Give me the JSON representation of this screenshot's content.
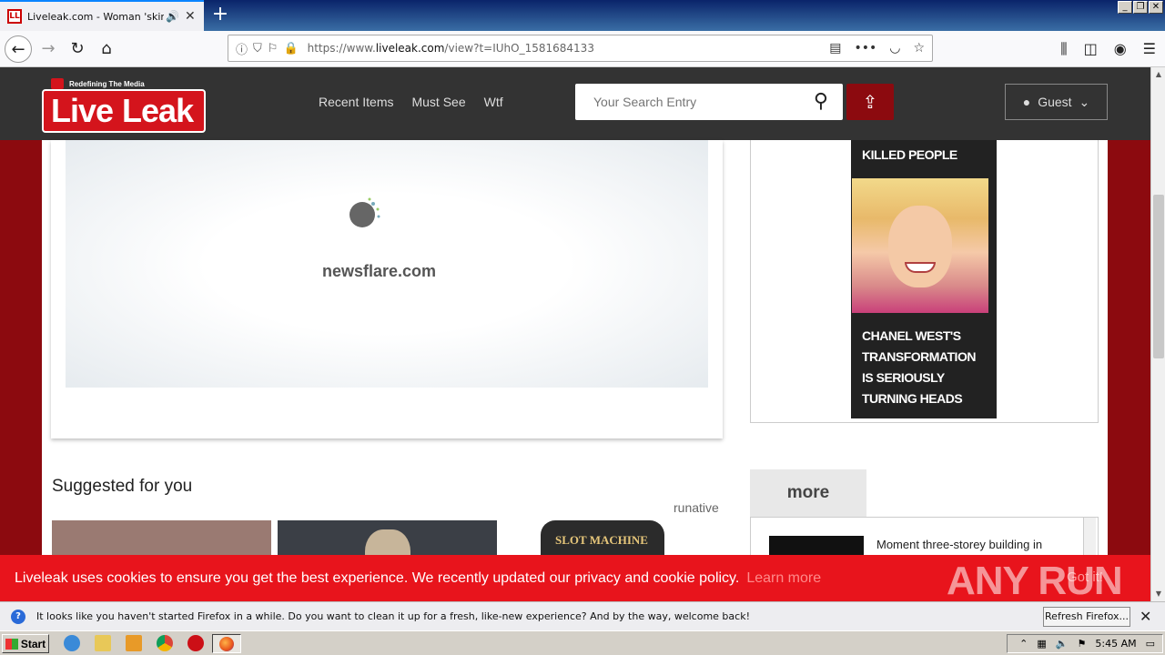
{
  "browser": {
    "tab_title": "Liveleak.com - Woman 'skinned",
    "favicon_text": "LL",
    "url_host": "https://www.",
    "url_domain": "liveleak.com",
    "url_path": "/view?t=IUhO_1581684133"
  },
  "site": {
    "logo_tagline": "Redefining The Media",
    "logo_live": "Live",
    "logo_leak": "Leak",
    "nav": [
      "Recent Items",
      "Must See",
      "Wtf"
    ],
    "search_placeholder": "Your Search Entry",
    "guest_label": "Guest"
  },
  "video": {
    "watermark": "newsflare.com"
  },
  "ad": {
    "headline": "KILLED PEOPLE",
    "caption": "CHANEL WEST'S TRANSFORMATION IS SERIOUSLY TURNING HEADS"
  },
  "suggested": {
    "title": "Suggested for you",
    "provider": "runative",
    "thumb3_text": "SLOT MACHINE"
  },
  "more": {
    "tab_label": "more",
    "item_text": "Moment three-storey building in"
  },
  "cookie": {
    "message": "Liveleak uses cookies to ensure you get the best experience. We recently updated our privacy and cookie policy.",
    "learn_more": "Learn more",
    "got_it": "Got it!",
    "watermark": "ANY RUN"
  },
  "notification": {
    "text": "It looks like you haven't started Firefox in a while. Do you want to clean it up for a fresh, like-new experience? And by the way, welcome back!",
    "button": "Refresh Firefox..."
  },
  "taskbar": {
    "start_label": "Start",
    "clock": "5:45 AM"
  }
}
